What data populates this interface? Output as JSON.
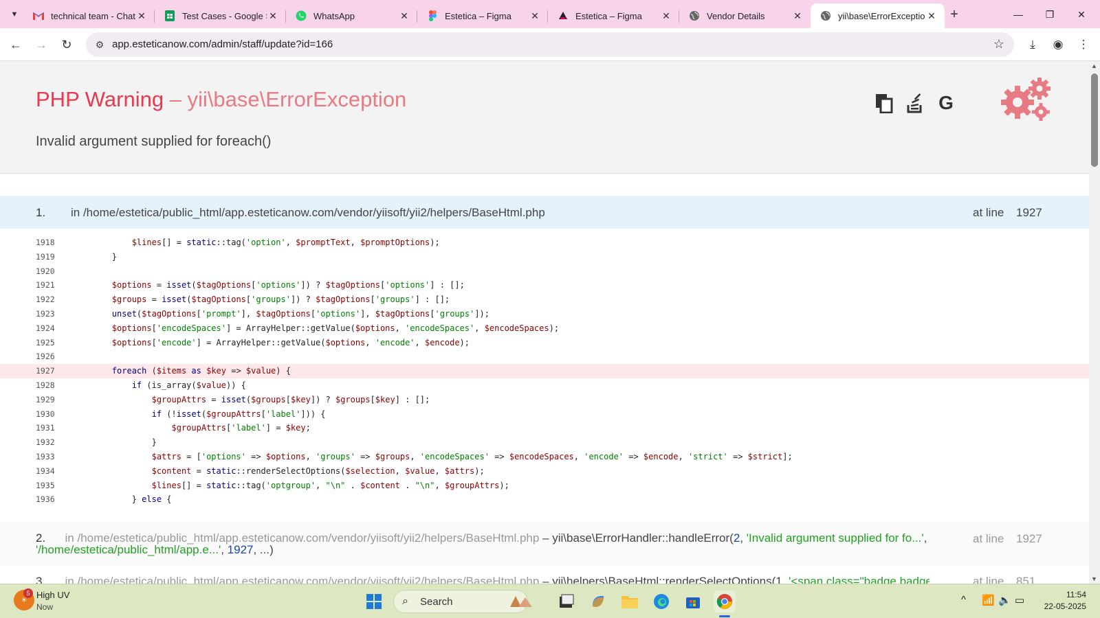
{
  "browser": {
    "tabs": [
      {
        "title": "technical team - Chat",
        "icon": "gmail-icon"
      },
      {
        "title": "Test Cases - Google Sh",
        "icon": "sheets-icon"
      },
      {
        "title": "WhatsApp",
        "icon": "whatsapp-icon"
      },
      {
        "title": "Estetica – Figma",
        "icon": "figma-icon"
      },
      {
        "title": "Estetica – Figma",
        "icon": "figma-dark-icon"
      },
      {
        "title": "Vendor Details",
        "icon": "globe-icon"
      },
      {
        "title": "yii\\base\\ErrorException",
        "icon": "globe-icon",
        "active": true
      }
    ],
    "url": "app.esteticanow.com/admin/staff/update?id=166"
  },
  "error": {
    "type_label": "PHP Warning",
    "dash": " – ",
    "exception": "yii\\base\\ErrorException",
    "message": "Invalid argument supplied for foreach()",
    "colors": {
      "title": "#e8394e",
      "exception": "#e87a84"
    }
  },
  "callstack": [
    {
      "num": "1.",
      "file": "in /home/estetica/public_html/app.esteticanow.com/vendor/yiisoft/yii2/helpers/BaseHtml.php",
      "at": "at line",
      "line": "1927"
    },
    {
      "num": "2.",
      "file": "in /home/estetica/public_html/app.esteticanow.com/vendor/yiisoft/yii2/helpers/BaseHtml.php",
      "func": " – yii\\base\\ErrorHandler::handleError(",
      "arg1": "2",
      "arg2": "'Invalid argument supplied for fo...'",
      "arg3": "'/home/estetica/public_html/app.e...'",
      "arg4": "1927",
      "tail": ", ...)",
      "at": "at line",
      "line": "1927"
    },
    {
      "num": "3.",
      "file": "in /home/estetica/public_html/app.esteticanow.com/vendor/yiisoft/yii2/helpers/BaseHtml.php",
      "func": " – yii\\helpers\\BaseHtml::renderSelectOptions(1, ",
      "arg": "'<span class=\"badge badge...",
      "at": "at line",
      "line": "851"
    }
  ],
  "code": {
    "highlight_line": 1927,
    "lines": [
      {
        "n": "1918",
        "html": "            <span class='v'>$lines</span>[] = <span class='k'>static</span>::tag(<span class='s'>'option'</span>, <span class='v'>$promptText</span>, <span class='v'>$promptOptions</span>);"
      },
      {
        "n": "1919",
        "html": "        }"
      },
      {
        "n": "1920",
        "html": ""
      },
      {
        "n": "1921",
        "html": "        <span class='v'>$options</span> = <span class='k'>isset</span>(<span class='v'>$tagOptions</span>[<span class='s'>'options'</span>]) ? <span class='v'>$tagOptions</span>[<span class='s'>'options'</span>] : [];"
      },
      {
        "n": "1922",
        "html": "        <span class='v'>$groups</span> = <span class='k'>isset</span>(<span class='v'>$tagOptions</span>[<span class='s'>'groups'</span>]) ? <span class='v'>$tagOptions</span>[<span class='s'>'groups'</span>] : [];"
      },
      {
        "n": "1923",
        "html": "        <span class='k'>unset</span>(<span class='v'>$tagOptions</span>[<span class='s'>'prompt'</span>], <span class='v'>$tagOptions</span>[<span class='s'>'options'</span>], <span class='v'>$tagOptions</span>[<span class='s'>'groups'</span>]);"
      },
      {
        "n": "1924",
        "html": "        <span class='v'>$options</span>[<span class='s'>'encodeSpaces'</span>] = ArrayHelper::getValue(<span class='v'>$options</span>, <span class='s'>'encodeSpaces'</span>, <span class='v'>$encodeSpaces</span>);"
      },
      {
        "n": "1925",
        "html": "        <span class='v'>$options</span>[<span class='s'>'encode'</span>] = ArrayHelper::getValue(<span class='v'>$options</span>, <span class='s'>'encode'</span>, <span class='v'>$encode</span>);"
      },
      {
        "n": "1926",
        "html": ""
      },
      {
        "n": "1927",
        "html": "        <span class='k'>foreach</span> (<span class='v'>$items</span> <span class='k'>as</span> <span class='v'>$key</span> => <span class='v'>$value</span>) {"
      },
      {
        "n": "1928",
        "html": "            <span class='k'>if</span> (is_array(<span class='v'>$value</span>)) {"
      },
      {
        "n": "1929",
        "html": "                <span class='v'>$groupAttrs</span> = <span class='k'>isset</span>(<span class='v'>$groups</span>[<span class='v'>$key</span>]) ? <span class='v'>$groups</span>[<span class='v'>$key</span>] : [];"
      },
      {
        "n": "1930",
        "html": "                <span class='k'>if</span> (!<span class='k'>isset</span>(<span class='v'>$groupAttrs</span>[<span class='s'>'label'</span>])) {"
      },
      {
        "n": "1931",
        "html": "                    <span class='v'>$groupAttrs</span>[<span class='s'>'label'</span>] = <span class='v'>$key</span>;"
      },
      {
        "n": "1932",
        "html": "                }"
      },
      {
        "n": "1933",
        "html": "                <span class='v'>$attrs</span> = [<span class='s'>'options'</span> => <span class='v'>$options</span>, <span class='s'>'groups'</span> => <span class='v'>$groups</span>, <span class='s'>'encodeSpaces'</span> => <span class='v'>$encodeSpaces</span>, <span class='s'>'encode'</span> => <span class='v'>$encode</span>, <span class='s'>'strict'</span> => <span class='v'>$strict</span>];"
      },
      {
        "n": "1934",
        "html": "                <span class='v'>$content</span> = <span class='k'>static</span>::renderSelectOptions(<span class='v'>$selection</span>, <span class='v'>$value</span>, <span class='v'>$attrs</span>);"
      },
      {
        "n": "1935",
        "html": "                <span class='v'>$lines</span>[] = <span class='k'>static</span>::tag(<span class='s'>'optgroup'</span>, <span class='s'>\"\\n\"</span> . <span class='v'>$content</span> . <span class='s'>\"\\n\"</span>, <span class='v'>$groupAttrs</span>);"
      },
      {
        "n": "1936",
        "html": "            } <span class='k'>else</span> {"
      }
    ]
  },
  "taskbar": {
    "weather_badge": "5",
    "weather_title": "High UV",
    "weather_sub": "Now",
    "search_label": "Search",
    "time": "11:54",
    "date": "22-05-2025"
  }
}
